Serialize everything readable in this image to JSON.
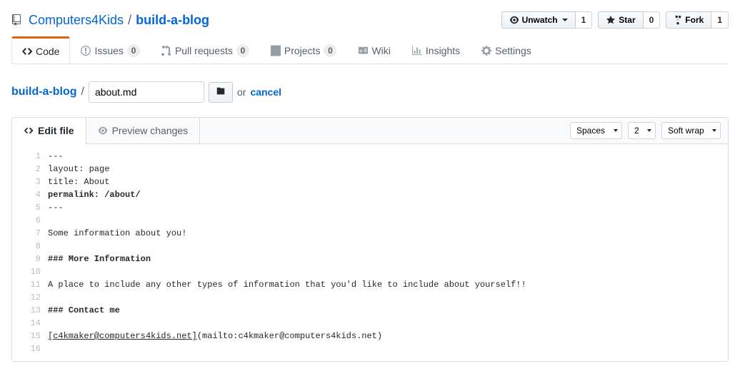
{
  "repo": {
    "owner": "Computers4Kids",
    "name": "build-a-blog"
  },
  "actions": {
    "watch": {
      "label": "Unwatch",
      "count": "1"
    },
    "star": {
      "label": "Star",
      "count": "0"
    },
    "fork": {
      "label": "Fork",
      "count": "1"
    }
  },
  "tabs": {
    "code": "Code",
    "issues": {
      "label": "Issues",
      "count": "0"
    },
    "pulls": {
      "label": "Pull requests",
      "count": "0"
    },
    "projects": {
      "label": "Projects",
      "count": "0"
    },
    "wiki": "Wiki",
    "insights": "Insights",
    "settings": "Settings"
  },
  "breadcrumb": {
    "root": "build-a-blog",
    "filename": "about.md",
    "or": "or",
    "cancel": "cancel"
  },
  "editor_tabs": {
    "edit": "Edit file",
    "preview": "Preview changes"
  },
  "editor_opts": {
    "indent": "Spaces",
    "size": "2",
    "wrap": "Soft wrap"
  },
  "code": {
    "l1": "---",
    "l2": "layout: page",
    "l3": "title: About",
    "l4": "permalink: /about/",
    "l5": "---",
    "l6": "",
    "l7": "Some information about you!",
    "l8": "",
    "l9": "### More Information",
    "l10": "",
    "l11": "A place to include any other types of information that you'd like to include about yourself!!",
    "l12": "",
    "l13": "### Contact me",
    "l14": "",
    "l15a": "[c4kmaker@computers4kids.net]",
    "l15b": "(mailto:c4kmaker@computers4kids.net)",
    "l16": ""
  },
  "linenums": {
    "n1": "1",
    "n2": "2",
    "n3": "3",
    "n4": "4",
    "n5": "5",
    "n6": "6",
    "n7": "7",
    "n8": "8",
    "n9": "9",
    "n10": "10",
    "n11": "11",
    "n12": "12",
    "n13": "13",
    "n14": "14",
    "n15": "15",
    "n16": "16"
  }
}
